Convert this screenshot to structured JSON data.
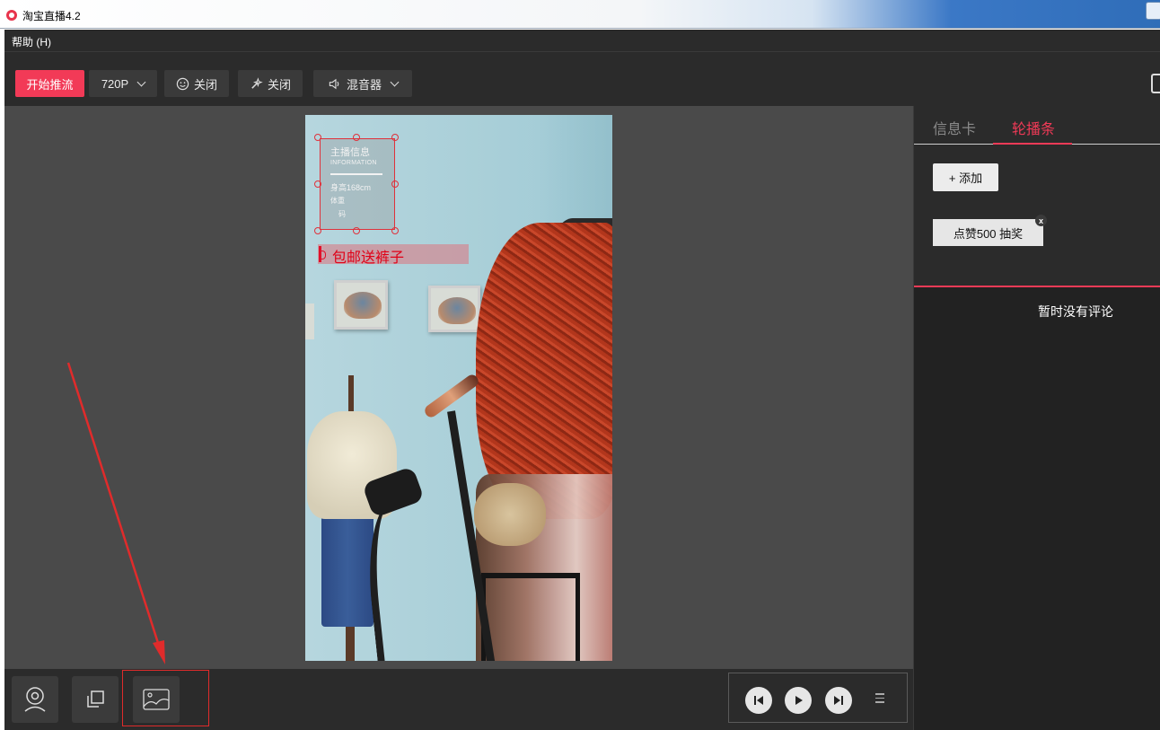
{
  "window": {
    "title": "淘宝直播4.2"
  },
  "menu": {
    "help_label": "帮助 (H)"
  },
  "toolbar": {
    "start_stream_label": "开始推流",
    "resolution_label": "720P",
    "beauty_label": "关闭",
    "filter_label": "关闭",
    "mixer_label": "混音器"
  },
  "info_card": {
    "title": "主播信息",
    "subtitle": "INFORMATION",
    "height": "身高168cm",
    "weight": "体重",
    "size": "码"
  },
  "ticker": {
    "text": "包邮送裤子"
  },
  "right_panel": {
    "tabs": [
      {
        "label": "信息卡",
        "active": false
      },
      {
        "label": "轮播条",
        "active": true
      }
    ],
    "add_button_label": "+ 添加",
    "ticker_item_label": "点赞500 抽奖",
    "ticker_item_close": "x",
    "empty_comments_text": "暂时没有评论"
  },
  "colors": {
    "accent": "#f23a57",
    "panel_bg": "#2b2b2b",
    "preview_bg": "#4a4a4a",
    "annotation": "#e02b2b"
  },
  "icons": {
    "app": "taobao-live-logo-icon",
    "beauty": "smile-icon",
    "filter": "magic-wand-icon",
    "mixer": "speaker-icon",
    "camera_source": "webcam-icon",
    "window_source": "window-capture-icon",
    "image_source": "image-icon",
    "prev": "skip-previous-icon",
    "play": "play-icon",
    "next": "skip-next-icon",
    "playlist": "playlist-icon"
  }
}
